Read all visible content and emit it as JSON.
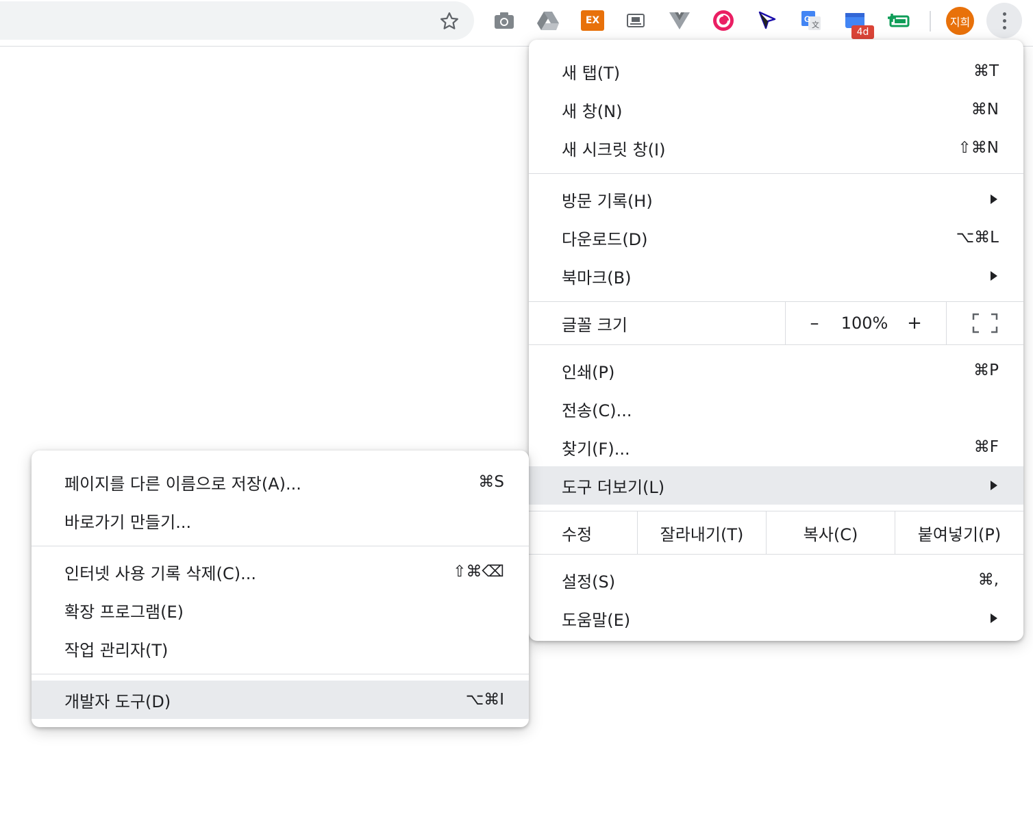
{
  "toolbar": {
    "bookmark_icon": "star-outline-icon",
    "extensions": [
      {
        "name": "camera-extension-icon",
        "color": "#80868b"
      },
      {
        "name": "drive-extension-icon",
        "color": "#80868b"
      },
      {
        "name": "ex-extension-icon",
        "label": "EX",
        "color": "#e8710a"
      },
      {
        "name": "notion-extension-icon",
        "color": "#5f6368"
      },
      {
        "name": "vue-devtools-icon",
        "color": "#9aa0a6"
      },
      {
        "name": "pocket-style-extension-icon",
        "color": "#ea1f63"
      },
      {
        "name": "cursor-arrow-extension-icon",
        "color": "#1a0dab"
      },
      {
        "name": "google-translate-icon",
        "color": "#4285f4"
      },
      {
        "name": "tab-counter-extension-icon",
        "color": "#4285f4"
      },
      {
        "name": "green-plus-extension-icon",
        "color": "#0f9d58"
      }
    ],
    "badge_label": "4d",
    "avatar_label": "지희",
    "avatar_color": "#e8710a"
  },
  "main_menu": {
    "group1": [
      {
        "label": "새 탭(T)",
        "shortcut": "⌘T"
      },
      {
        "label": "새 창(N)",
        "shortcut": "⌘N"
      },
      {
        "label": "새 시크릿 창(I)",
        "shortcut": "⇧⌘N"
      }
    ],
    "group2": [
      {
        "label": "방문 기록(H)",
        "shortcut": ""
      },
      {
        "label": "다운로드(D)",
        "shortcut": "⌥⌘L"
      },
      {
        "label": "북마크(B)",
        "shortcut": ""
      }
    ],
    "zoom": {
      "label": "글꼴 크기",
      "minus": "–",
      "value": "100%",
      "plus": "+"
    },
    "group3": [
      {
        "label": "인쇄(P)",
        "shortcut": "⌘P"
      },
      {
        "label": "전송(C)...",
        "shortcut": ""
      },
      {
        "label": "찾기(F)...",
        "shortcut": "⌘F"
      },
      {
        "label": "도구 더보기(L)",
        "shortcut": ""
      }
    ],
    "edit": {
      "label": "수정",
      "cut": "잘라내기(T)",
      "copy": "복사(C)",
      "paste": "붙여넣기(P)"
    },
    "group4": [
      {
        "label": "설정(S)",
        "shortcut": "⌘,"
      },
      {
        "label": "도움말(E)",
        "shortcut": ""
      }
    ]
  },
  "sub_menu": {
    "group1": [
      {
        "label": "페이지를 다른 이름으로 저장(A)...",
        "shortcut": "⌘S"
      },
      {
        "label": "바로가기 만들기...",
        "shortcut": ""
      }
    ],
    "group2": [
      {
        "label": "인터넷 사용 기록 삭제(C)...",
        "shortcut": "⇧⌘⌫"
      },
      {
        "label": "확장 프로그램(E)",
        "shortcut": ""
      },
      {
        "label": "작업 관리자(T)",
        "shortcut": ""
      }
    ],
    "group3": [
      {
        "label": "개발자 도구(D)",
        "shortcut": "⌥⌘I"
      }
    ]
  }
}
